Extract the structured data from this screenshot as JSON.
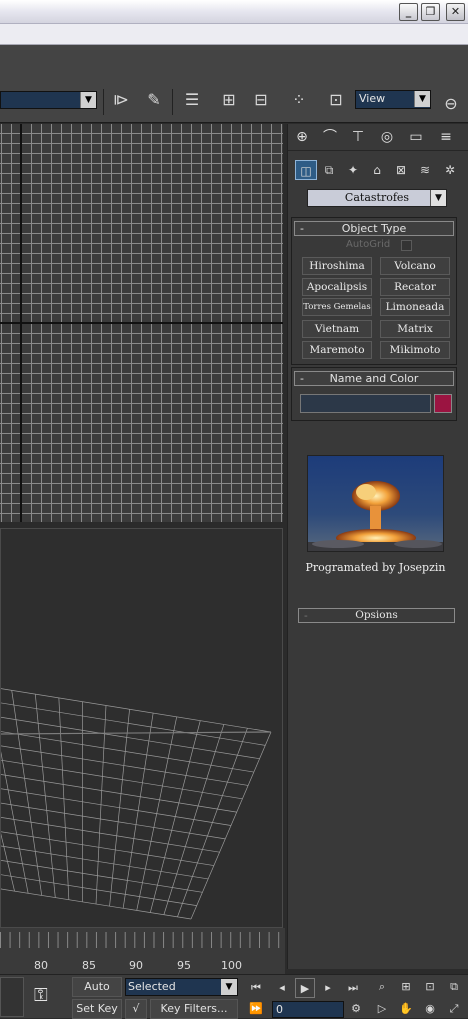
{
  "window": {
    "min_btn": "_",
    "max_btn": "❐",
    "close_btn": "✕"
  },
  "toolbar": {
    "view_combo": {
      "value": "View"
    },
    "icons": [
      "mirror-icon",
      "align-icon",
      "layer-manager-icon",
      "curve-editor-icon",
      "schematic-view-icon",
      "material-editor-icon",
      "render-setup-icon",
      "render-teapot-icon"
    ]
  },
  "command_panel": {
    "tabs": [
      "create-tab-icon",
      "modify-tab-icon",
      "hierarchy-tab-icon",
      "motion-tab-icon",
      "display-tab-icon",
      "utilities-tab-icon"
    ],
    "subcategories": [
      "geometry-icon",
      "shapes-icon",
      "lights-icon",
      "cameras-icon",
      "helpers-icon",
      "spacewarps-icon",
      "systems-icon"
    ],
    "category_dropdown": "Catastrofes",
    "object_type": {
      "title": "Object Type",
      "autogrid_label": "AutoGrid",
      "buttons": [
        "Hiroshima",
        "Volcano",
        "Apocalipsis",
        "Recator",
        "Torres Gemelas",
        "Limoneada",
        "Vietnam",
        "Matrix",
        "Maremoto",
        "Mikimoto"
      ]
    },
    "name_and_color": {
      "title": "Name and Color",
      "name_value": "",
      "color": "#9b1441"
    },
    "credit": "Programated by Josepzin",
    "opsions_title": "Opsions"
  },
  "timeline": {
    "ticks": [
      "80",
      "85",
      "90",
      "95",
      "100"
    ]
  },
  "status": {
    "auto_key": "Auto Key",
    "set_key": "Set Key",
    "selected_combo": "Selected",
    "key_filters": "Key Filters...",
    "frame_value": "0"
  },
  "colors": {
    "viewport_bg": "#3b3b3b",
    "grid_line": "#8a8a8a",
    "panel_bg": "#393939",
    "accent": "#1f3550"
  }
}
